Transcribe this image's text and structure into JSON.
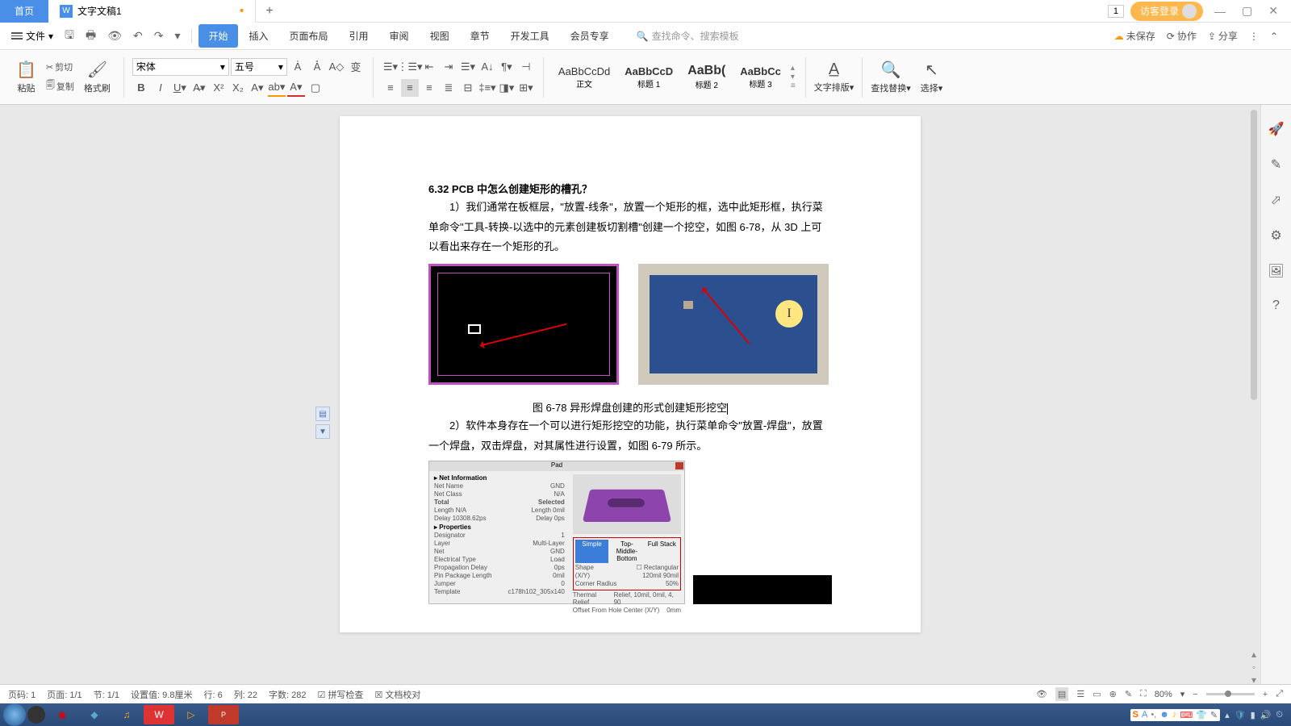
{
  "titlebar": {
    "home_tab": "首页",
    "doc_tab": "文字文稿1",
    "badge": "1",
    "guest": "访客登录"
  },
  "menu": {
    "file": "文件",
    "items": [
      "开始",
      "插入",
      "页面布局",
      "引用",
      "审阅",
      "视图",
      "章节",
      "开发工具",
      "会员专享"
    ],
    "search_ph": "查找命令、搜索模板",
    "unsaved": "未保存",
    "collab": "协作",
    "share": "分享"
  },
  "ribbon": {
    "paste": "粘贴",
    "cut": "剪切",
    "copy": "复制",
    "format_painter": "格式刷",
    "font_name": "宋体",
    "font_size": "五号",
    "styles": {
      "s1_prev": "AaBbCcDd",
      "s1": "正文",
      "s2_prev": "AaBbCcD",
      "s2": "标题 1",
      "s3_prev": "AaBb(",
      "s3": "标题 2",
      "s4_prev": "AaBbCc",
      "s4": "标题 3"
    },
    "text_layout": "文字排版",
    "find_replace": "查找替换",
    "select": "选择"
  },
  "doc": {
    "heading": "6.32   PCB 中怎么创建矩形的槽孔？",
    "p1": "1）我们通常在板框层，\"放置-线条\"，放置一个矩形的框，选中此矩形框，执行菜单命令\"工具-转换-以选中的元素创建板切割槽\"创建一个挖空，如图 6-78，从 3D 上可以看出来存在一个矩形的孔。",
    "caption1": "图 6-78 异形焊盘创建的形式创建矩形挖空",
    "p2": "2）软件本身存在一个可以进行矩形挖空的功能，执行菜单命令\"放置-焊盘\"，放置一个焊盘，双击焊盘，对其属性进行设置，如图 6-79 所示。",
    "dlg": {
      "title": "Pad",
      "sec1": "▸ Net Information",
      "r1a": "Net Name",
      "r1b": "GND",
      "r2a": "Net Class",
      "r2b": "N/A",
      "thead1": "Total",
      "thead2": "Selected",
      "r3a": "Length  N/A",
      "r3b": "Length  0mil",
      "r4a": "Delay  10308.62ps",
      "r4b": "Delay  0ps",
      "sec2": "▸ Properties",
      "r5a": "Designator",
      "r5b": "1",
      "r6a": "Layer",
      "r6b": "Multi-Layer",
      "r7a": "Net",
      "r7b": "GND",
      "r8a": "Electrical Type",
      "r8b": "Load",
      "r9a": "Propagation Delay",
      "r9b": "0ps",
      "r10a": "Pin Package Length",
      "r10b": "0mil",
      "r11a": "Jumper",
      "r11b": "0",
      "r12a": "Template",
      "r12b": "c178h102_305x140",
      "tab1": "Simple",
      "tab2": "Top-Middle-Bottom",
      "tab3": "Full Stack",
      "rs1": "Shape",
      "rs1v": "☐ Rectangular",
      "rs2": "(X/Y)",
      "rs2v": "120mil        90mil",
      "rs3": "Corner Radius",
      "rs3v": "50%",
      "rs4": "Thermal Relief",
      "rs4v": "Relief, 10mil, 0mil, 4, 90",
      "rs5": "Offset From Hole Center (X/Y)",
      "rs5v": "0mm"
    }
  },
  "status": {
    "page_no": "页码: 1",
    "page": "页面: 1/1",
    "section": "节: 1/1",
    "setval": "设置值: 9.8厘米",
    "line": "行: 6",
    "col": "列: 22",
    "words": "字数: 282",
    "spell": "拼写检查",
    "doc_check": "文档校对",
    "zoom": "80%"
  },
  "tray": {
    "ime": "A"
  }
}
